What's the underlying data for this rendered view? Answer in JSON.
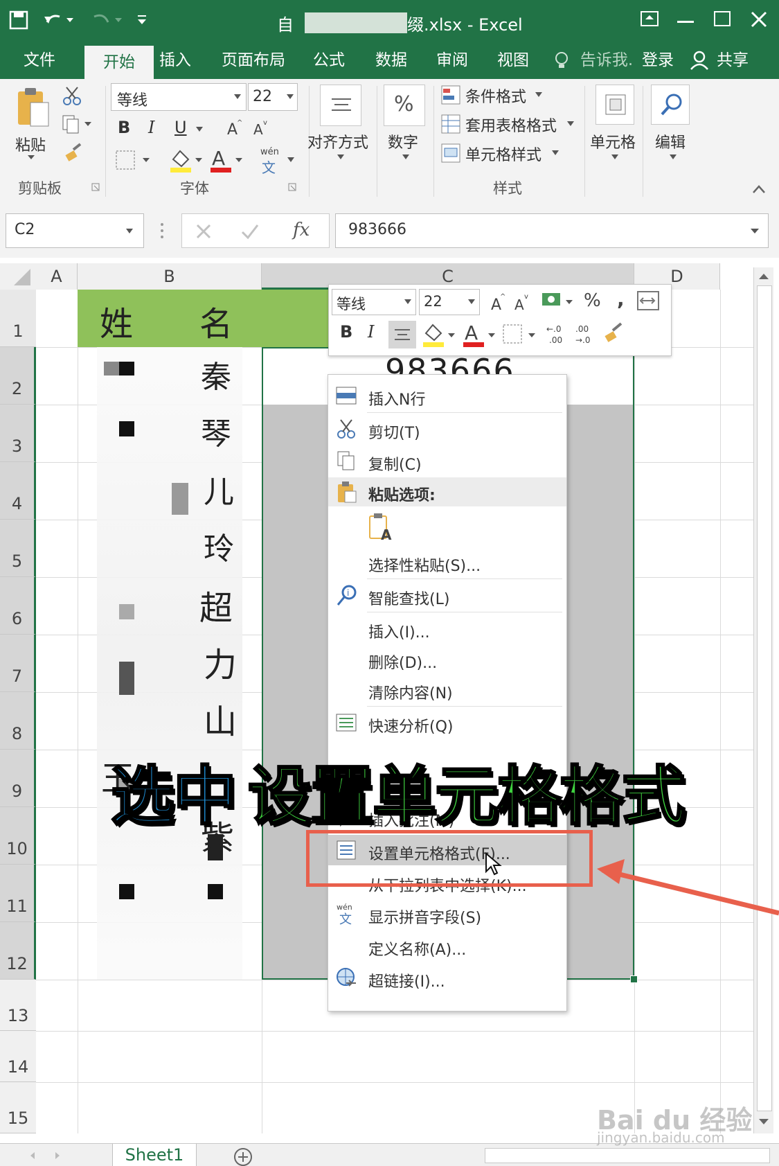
{
  "window": {
    "title_prefix": "自",
    "title_suffix": "缀.xlsx - Excel"
  },
  "tabs": [
    "文件",
    "开始",
    "插入",
    "页面布局",
    "公式",
    "数据",
    "审阅",
    "视图"
  ],
  "tell_me": "告诉我.",
  "login": "登录",
  "share": "共享",
  "ribbon": {
    "paste": "粘贴",
    "clipboard_group": "剪贴板",
    "font_name": "等线",
    "font_size": "22",
    "bold": "B",
    "italic": "I",
    "underline": "U",
    "font_group": "字体",
    "alignment": "对齐方式",
    "number": "数字",
    "number_symbol": "%",
    "conditional_format": "条件格式",
    "table_format": "套用表格格式",
    "cell_style": "单元格样式",
    "styles_group": "样式",
    "cells": "单元格",
    "editing": "编辑",
    "wen": "wén",
    "wen_char": "文"
  },
  "formula_bar": {
    "name_box": "C2",
    "fx": "fx",
    "value": "983666"
  },
  "columns": [
    "A",
    "B",
    "C",
    "D"
  ],
  "rows": [
    "1",
    "2",
    "3",
    "4",
    "5",
    "6",
    "7",
    "8",
    "9",
    "10",
    "11",
    "12",
    "13",
    "14",
    "15"
  ],
  "cells": {
    "header_b1_char1": "姓",
    "header_b1_char2": "名",
    "c2_value": "983666",
    "b_col_chars": [
      "秦",
      "琴",
      "儿",
      "玲",
      "超",
      "力",
      "山",
      "玉",
      "紫"
    ]
  },
  "mini_toolbar": {
    "font_name": "等线",
    "font_size": "22",
    "percent": "%",
    "comma": ",",
    "bold": "B",
    "italic": "I",
    "font_color": "A"
  },
  "context_menu": {
    "items": [
      "插入N行",
      "剪切(T)",
      "复制(C)",
      "粘贴选项:",
      "选择性粘贴(S)...",
      "智能查找(L)",
      "插入(I)...",
      "删除(D)...",
      "清除内容(N)",
      "快速分析(Q)",
      "插入批注(M)",
      "设置单元格格式(F)...",
      "从下拉列表中选择(K)...",
      "显示拼音字段(S)",
      "定义名称(A)...",
      "超链接(I)..."
    ],
    "highlighted_index": 11,
    "highlight_color": "#e8604c"
  },
  "caption": {
    "part1": "选中",
    "part2": "设置单元格格式",
    "color1": "#1f8fd6",
    "color2": "#3fd13f"
  },
  "sheet_tab": "Sheet1",
  "watermark": {
    "logo": "Bai du 经验",
    "url": "jingyan.baidu.com"
  },
  "colors": {
    "excel_green": "#217346",
    "header_fill": "#8fc15a",
    "selection_gray": "#c4c4c4"
  }
}
